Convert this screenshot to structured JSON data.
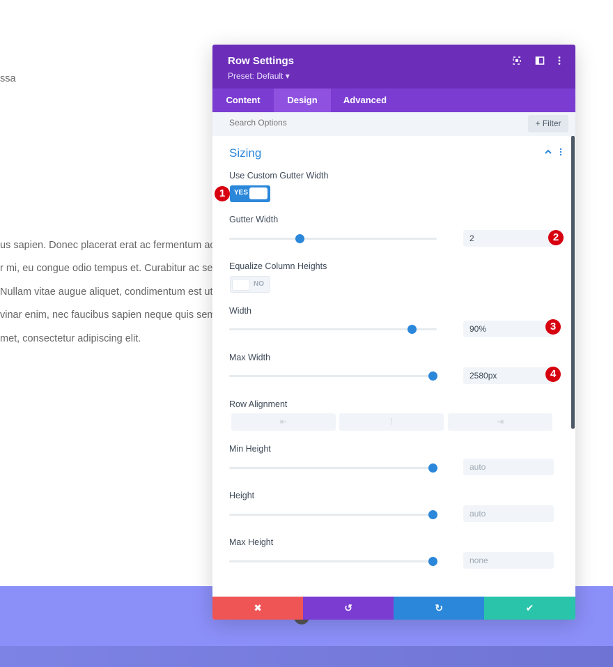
{
  "background": {
    "lines": [
      "ssa",
      "us sapien. Donec placerat erat ac fermentum acc",
      "r mi, eu congue odio tempus et. Curabitur ac sem",
      "Nullam vitae augue aliquet, condimentum est ut, v",
      "vinar enim, nec faucibus sapien neque quis sem. V",
      "met, consectetur adipiscing elit."
    ]
  },
  "modal": {
    "title": "Row Settings",
    "preset": "Preset: Default ▾",
    "icons": [
      "expand-icon",
      "sidebar-icon",
      "more-icon"
    ],
    "tabs": [
      "Content",
      "Design",
      "Advanced"
    ],
    "active_tab": "Design",
    "search_placeholder": "Search Options",
    "filter_label": "+ Filter",
    "section_title": "Sizing",
    "fields": {
      "custom_gutter": {
        "label": "Use Custom Gutter Width",
        "toggle": "YES"
      },
      "gutter_width": {
        "label": "Gutter Width",
        "value": "2",
        "slider": 0.34
      },
      "equalize": {
        "label": "Equalize Column Heights",
        "toggle": "NO"
      },
      "width": {
        "label": "Width",
        "value": "90%",
        "slider": 0.88
      },
      "max_width": {
        "label": "Max Width",
        "value": "2580px",
        "slider": 0.98
      },
      "row_alignment": {
        "label": "Row Alignment",
        "options": [
          "⇤",
          "⁞",
          "⇥"
        ]
      },
      "min_height": {
        "label": "Min Height",
        "value": "auto",
        "slider": 0.98
      },
      "height": {
        "label": "Height",
        "value": "auto",
        "slider": 0.98
      },
      "max_height": {
        "label": "Max Height",
        "value": "none",
        "slider": 0.98
      }
    },
    "badges": [
      "1",
      "2",
      "3",
      "4"
    ],
    "footer": {
      "cancel": "✖",
      "undo": "↺",
      "redo": "↻",
      "save": "✔"
    },
    "colors": {
      "header": "#6c2eb9",
      "tabs": "#7b3cd1",
      "accent": "#2b87da",
      "cancel": "#ef5555",
      "undo": "#7b3cd1",
      "redo": "#2b87da",
      "save": "#29c4a9",
      "badge": "#d7000f"
    }
  }
}
